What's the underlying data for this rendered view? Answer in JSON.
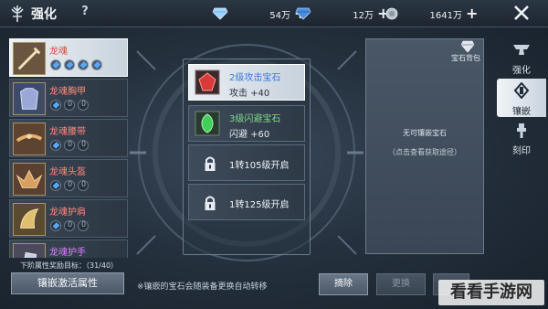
{
  "topbar": {
    "title": "强化",
    "help": "?",
    "currencies": [
      {
        "icon": "diamond-icon",
        "amount": "54万",
        "plus": "+"
      },
      {
        "icon": "blue-gem-icon",
        "amount": "12万",
        "plus": "+"
      },
      {
        "icon": "silver-coin-icon",
        "amount": "1641万",
        "plus": "+"
      }
    ]
  },
  "equipment": [
    {
      "name": "龙魂",
      "sockets": [
        "gem",
        "gem",
        "gem",
        "gem"
      ]
    },
    {
      "name": "龙魂胸甲",
      "sockets": [
        "gem",
        "zero",
        "zero"
      ]
    },
    {
      "name": "龙魂腰带",
      "sockets": [
        "gem",
        "zero",
        "zero"
      ]
    },
    {
      "name": "龙魂头盔",
      "sockets": [
        "gem",
        "zero",
        "zero"
      ]
    },
    {
      "name": "龙魂护肩",
      "sockets": [
        "gem",
        "zero",
        "zero"
      ]
    },
    {
      "name": "龙魂护手",
      "sockets": []
    }
  ],
  "progress_text": "下阶属性奖励目标：（31/40）",
  "inlay_attr_button": "镶嵌激活属性",
  "gem_slots": [
    {
      "name": "2级攻击宝石",
      "stat": "攻击  +40",
      "color": "#d83a3a"
    },
    {
      "name": "3级闪避宝石",
      "stat": "闪避  +60",
      "color": "#3fcf5a"
    }
  ],
  "locked_slots": [
    {
      "text": "1转105级开启"
    },
    {
      "text": "1转125级开启"
    }
  ],
  "info_panel": {
    "bag_label": "宝石背包",
    "empty_title": "无可镶嵌宝石",
    "empty_hint": "（点击查看获取途径）"
  },
  "side_tabs": [
    {
      "label": "强化"
    },
    {
      "label": "镶嵌"
    },
    {
      "label": "刻印"
    }
  ],
  "bottom": {
    "note": "※镶嵌的宝石会随装备更换自动转移",
    "remove": "摘除",
    "replace": "更换",
    "third": ""
  },
  "watermark": "看看手游网"
}
